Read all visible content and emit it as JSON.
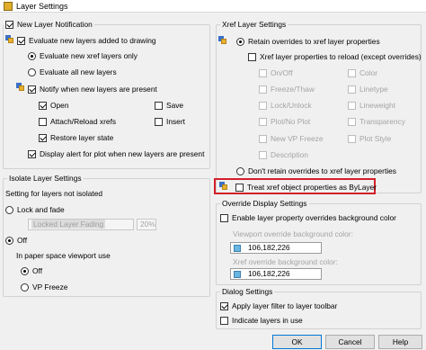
{
  "window": {
    "title": "Layer Settings"
  },
  "new_layer_notification": {
    "label": "New Layer Notification",
    "evaluate_new_layers": "Evaluate new layers added to drawing",
    "evaluate_xref_only": "Evaluate new xref layers only",
    "evaluate_all": "Evaluate all new layers",
    "notify_present": "Notify when new layers are present",
    "open": "Open",
    "save": "Save",
    "attach_reload": "Attach/Reload xrefs",
    "insert": "Insert",
    "restore_state": "Restore layer state",
    "display_alert": "Display alert for plot when new layers are present"
  },
  "xref_layer_settings": {
    "label": "Xref Layer Settings",
    "retain_overrides": "Retain overrides to xref layer properties",
    "props_to_reload": "Xref layer properties to reload (except overrides)",
    "props": {
      "on_off": "On/Off",
      "color": "Color",
      "freeze_thaw": "Freeze/Thaw",
      "linetype": "Linetype",
      "lock_unlock": "Lock/Unlock",
      "lineweight": "Lineweight",
      "plot_no_plot": "Plot/No Plot",
      "transparency": "Transparency",
      "new_vp_freeze": "New VP Freeze",
      "plot_style": "Plot Style",
      "description": "Description"
    },
    "dont_retain": "Don't retain overrides to xref layer properties",
    "treat_bylayer": "Treat xref object properties as ByLayer"
  },
  "isolate_layer_settings": {
    "label": "Isolate Layer Settings",
    "subtitle": "Setting for layers not isolated",
    "lock_and_fade": "Lock and fade",
    "locked_layer_fading": "Locked Layer Fading",
    "fading_value": "20%",
    "off": "Off",
    "paper_space_label": "In paper space viewport use",
    "off_option": "Off",
    "vp_freeze": "VP Freeze"
  },
  "override_display": {
    "label": "Override Display Settings",
    "enable_bg_color": "Enable layer property overrides background color",
    "viewport_bg_label": "Viewport override background color:",
    "viewport_bg_value": "106,182,226",
    "xref_bg_label": "Xref override background color:",
    "xref_bg_value": "106,182,226",
    "swatch_color": "#6ab6e2"
  },
  "dialog_settings": {
    "label": "Dialog Settings",
    "apply_filter": "Apply layer filter to layer toolbar",
    "indicate_in_use": "Indicate layers in use"
  },
  "buttons": {
    "ok": "OK",
    "cancel": "Cancel",
    "help": "Help"
  }
}
